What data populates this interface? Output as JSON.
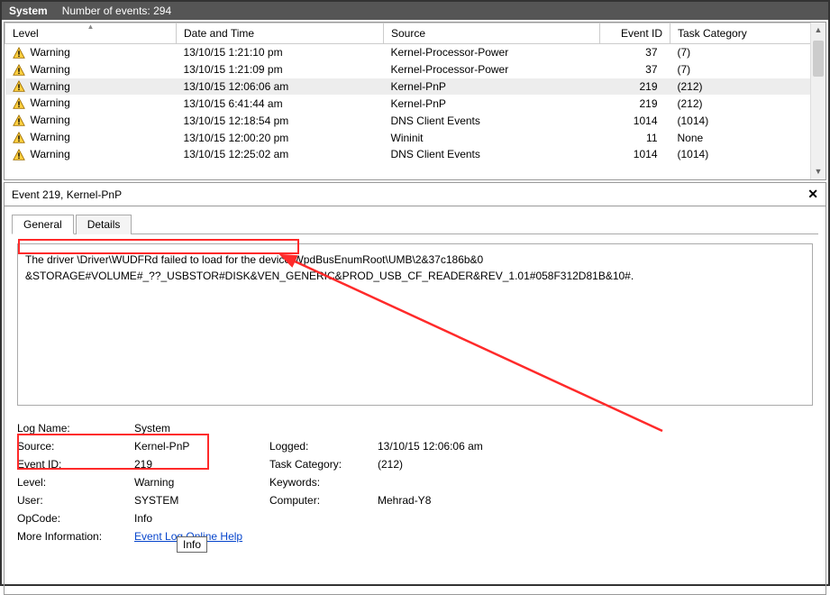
{
  "header": {
    "title": "System",
    "events_label": "Number of events:",
    "events_count": "294"
  },
  "columns": {
    "level": "Level",
    "datetime": "Date and Time",
    "source": "Source",
    "eventid": "Event ID",
    "task": "Task Category"
  },
  "rows": [
    {
      "level": "Warning",
      "datetime": "13/10/15 1:21:10 pm",
      "source": "Kernel-Processor-Power",
      "eventid": "37",
      "task": "(7)"
    },
    {
      "level": "Warning",
      "datetime": "13/10/15 1:21:09 pm",
      "source": "Kernel-Processor-Power",
      "eventid": "37",
      "task": "(7)"
    },
    {
      "level": "Warning",
      "datetime": "13/10/15 12:06:06 am",
      "source": "Kernel-PnP",
      "eventid": "219",
      "task": "(212)",
      "selected": true
    },
    {
      "level": "Warning",
      "datetime": "13/10/15 6:41:44 am",
      "source": "Kernel-PnP",
      "eventid": "219",
      "task": "(212)"
    },
    {
      "level": "Warning",
      "datetime": "13/10/15 12:18:54 pm",
      "source": "DNS Client Events",
      "eventid": "1014",
      "task": "(1014)"
    },
    {
      "level": "Warning",
      "datetime": "13/10/15 12:00:20 pm",
      "source": "Wininit",
      "eventid": "11",
      "task": "None"
    },
    {
      "level": "Warning",
      "datetime": "13/10/15 12:25:02 am",
      "source": "DNS Client Events",
      "eventid": "1014",
      "task": "(1014)"
    }
  ],
  "detail": {
    "title": "Event 219, Kernel-PnP",
    "tabs": {
      "general": "General",
      "details": "Details"
    },
    "description_part1": "The driver \\Driver\\WUDFRd failed to load for the device ",
    "description_part2": "WpdBusEnumRoot\\UMB\\2&37c186b&0",
    "description_line2": "&STORAGE#VOLUME#_??_USBSTOR#DISK&VEN_GENERIC&PROD_USB_CF_READER&REV_1.01#058F312D81B&10#.",
    "labels": {
      "logname": "Log Name:",
      "source": "Source:",
      "eventid": "Event ID:",
      "level": "Level:",
      "user": "User:",
      "opcode": "OpCode:",
      "moreinfo": "More Information:",
      "logged": "Logged:",
      "taskcat": "Task Category:",
      "keywords": "Keywords:",
      "computer": "Computer:"
    },
    "values": {
      "logname": "System",
      "source": "Kernel-PnP",
      "eventid": "219",
      "level": "Warning",
      "user": "SYSTEM",
      "opcode": "Info",
      "moreinfo": "Event Log Online Help",
      "logged": "13/10/15 12:06:06 am",
      "taskcat": "(212)",
      "keywords": "",
      "computer": "Mehrad-Y8"
    },
    "tooltip": "Info"
  }
}
